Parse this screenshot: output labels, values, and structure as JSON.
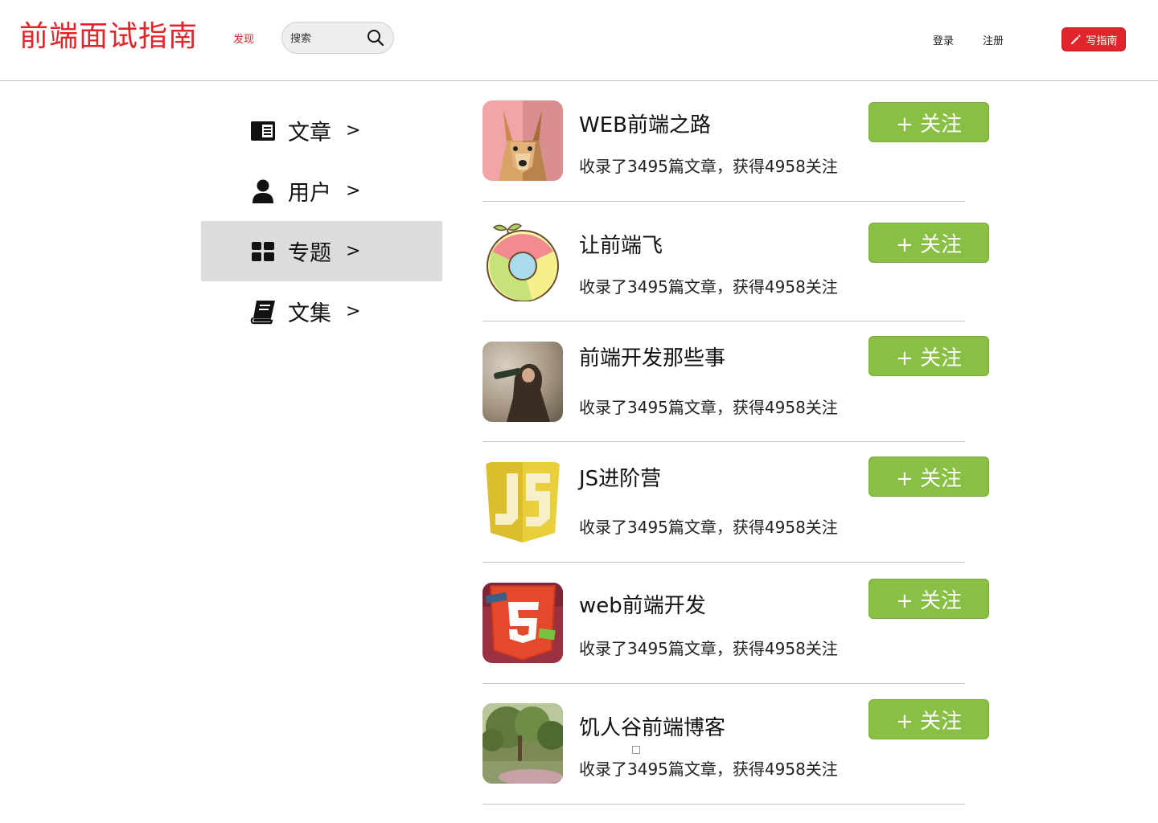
{
  "header": {
    "logo": "前端面试指南",
    "discover": "发现",
    "search_placeholder": "搜索",
    "login": "登录",
    "register": "注册",
    "write": "写指南"
  },
  "sidebar": {
    "items": [
      {
        "label": "文章",
        "chevron": ">",
        "icon": "article-icon"
      },
      {
        "label": "用户",
        "chevron": ">",
        "icon": "user-icon"
      },
      {
        "label": "专题",
        "chevron": ">",
        "icon": "grid-icon"
      },
      {
        "label": "文集",
        "chevron": ">",
        "icon": "book-icon"
      }
    ]
  },
  "topics": [
    {
      "title": "WEB前端之路",
      "desc": "收录了3495篇文章，获得4958关注",
      "follow": "+ 关注",
      "avatar": "dog-icon"
    },
    {
      "title": "让前端飞",
      "desc": "收录了3495篇文章，获得4958关注",
      "follow": "+ 关注",
      "avatar": "chrome-sprout-icon"
    },
    {
      "title": "前端开发那些事",
      "desc": "收录了3495篇文章，获得4958关注",
      "follow": "+ 关注",
      "avatar": "child-photo"
    },
    {
      "title": "JS进阶营",
      "desc": "收录了3495篇文章，获得4958关注",
      "follow": "+ 关注",
      "avatar": "js-shield-icon"
    },
    {
      "title": "web前端开发",
      "desc": "收录了3495篇文章，获得4958关注",
      "follow": "+ 关注",
      "avatar": "html5-pocket-icon"
    },
    {
      "title": "饥人谷前端博客",
      "desc": "收录了3495篇文章，获得4958关注",
      "follow": "+ 关注",
      "avatar": "tree-photo"
    }
  ],
  "colors": {
    "brand": "#e0262a",
    "follow": "#88bf44",
    "active_bg": "#dcdcdc"
  }
}
